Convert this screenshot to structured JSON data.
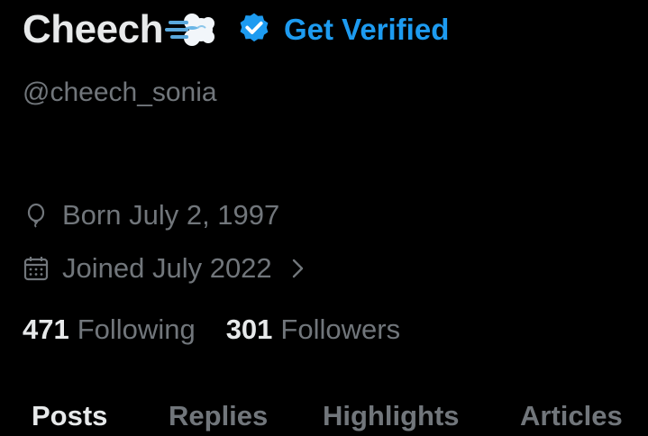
{
  "profile": {
    "display_name": "Cheech",
    "name_emoji": "dashing-away-emoji",
    "verify_link": "Get Verified",
    "handle": "@cheech_sonia",
    "born": "Born July 2, 1997",
    "joined": "Joined July 2022"
  },
  "stats": {
    "following_count": "471",
    "following_label": "Following",
    "followers_count": "301",
    "followers_label": "Followers"
  },
  "tabs": [
    {
      "label": "Posts",
      "active": true
    },
    {
      "label": "Replies",
      "active": false
    },
    {
      "label": "Highlights",
      "active": false
    },
    {
      "label": "Articles",
      "active": false
    }
  ],
  "icons": {
    "verified": "verified-badge-icon",
    "born": "balloon-icon",
    "joined": "calendar-icon",
    "more": "chevron-right-icon"
  },
  "colors": {
    "background": "#000000",
    "primary_text": "#e7e9ea",
    "secondary_text": "#71767b",
    "accent": "#1d9bf0"
  }
}
